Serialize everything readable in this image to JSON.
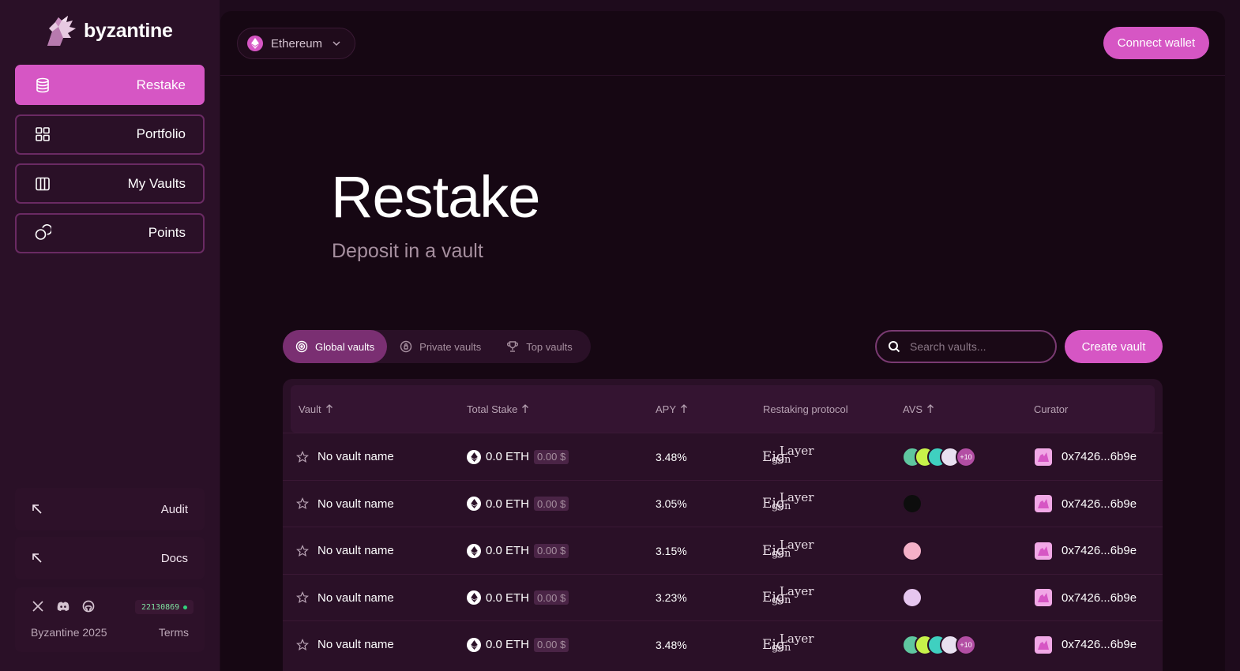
{
  "brand": {
    "name": "byzantine"
  },
  "sidebar": {
    "nav": [
      {
        "label": "Restake",
        "icon": "database-icon",
        "active": true
      },
      {
        "label": "Portfolio",
        "icon": "grid-icon",
        "active": false
      },
      {
        "label": "My Vaults",
        "icon": "columns-icon",
        "active": false
      },
      {
        "label": "Points",
        "icon": "coins-icon",
        "active": false
      }
    ],
    "links": [
      {
        "label": "Audit",
        "icon": "arrow-up-left-icon"
      },
      {
        "label": "Docs",
        "icon": "arrow-up-left-icon"
      }
    ],
    "footer": {
      "block_number": "22130869",
      "copyright": "Byzantine 2025",
      "terms": "Terms"
    }
  },
  "topbar": {
    "network": "Ethereum",
    "connect_label": "Connect wallet"
  },
  "hero": {
    "title": "Restake",
    "subtitle": "Deposit in a vault"
  },
  "tabs": [
    {
      "label": "Global vaults",
      "icon": "target-icon",
      "active": true
    },
    {
      "label": "Private vaults",
      "icon": "lock-circle-icon",
      "active": false
    },
    {
      "label": "Top vaults",
      "icon": "trophy-icon",
      "active": false
    }
  ],
  "search": {
    "placeholder": "Search vaults..."
  },
  "create_label": "Create vault",
  "table": {
    "headers": {
      "vault": "Vault",
      "stake": "Total Stake",
      "apy": "APY",
      "protocol": "Restaking protocol",
      "avs": "AVS",
      "curator": "Curator"
    },
    "protocol_text": {
      "a": "Eig",
      "b": "Layer",
      "c": "gen"
    },
    "rows": [
      {
        "name": "No vault name",
        "stake": "0.0 ETH",
        "usd": "0.00 $",
        "apy": "3.48%",
        "avs_more": "+10",
        "curator": "0x7426...6b9e"
      },
      {
        "name": "No vault name",
        "stake": "0.0 ETH",
        "usd": "0.00 $",
        "apy": "3.05%",
        "avs_more": "",
        "curator": "0x7426...6b9e"
      },
      {
        "name": "No vault name",
        "stake": "0.0 ETH",
        "usd": "0.00 $",
        "apy": "3.15%",
        "avs_more": "",
        "curator": "0x7426...6b9e"
      },
      {
        "name": "No vault name",
        "stake": "0.0 ETH",
        "usd": "0.00 $",
        "apy": "3.23%",
        "avs_more": "",
        "curator": "0x7426...6b9e"
      },
      {
        "name": "No vault name",
        "stake": "0.0 ETH",
        "usd": "0.00 $",
        "apy": "3.48%",
        "avs_more": "+10",
        "curator": "0x7426...6b9e"
      }
    ]
  },
  "colors": {
    "accent": "#d656c4",
    "sidebar_bg": "#2a1027",
    "main_bg": "#160713",
    "status_green": "#31d27c"
  }
}
